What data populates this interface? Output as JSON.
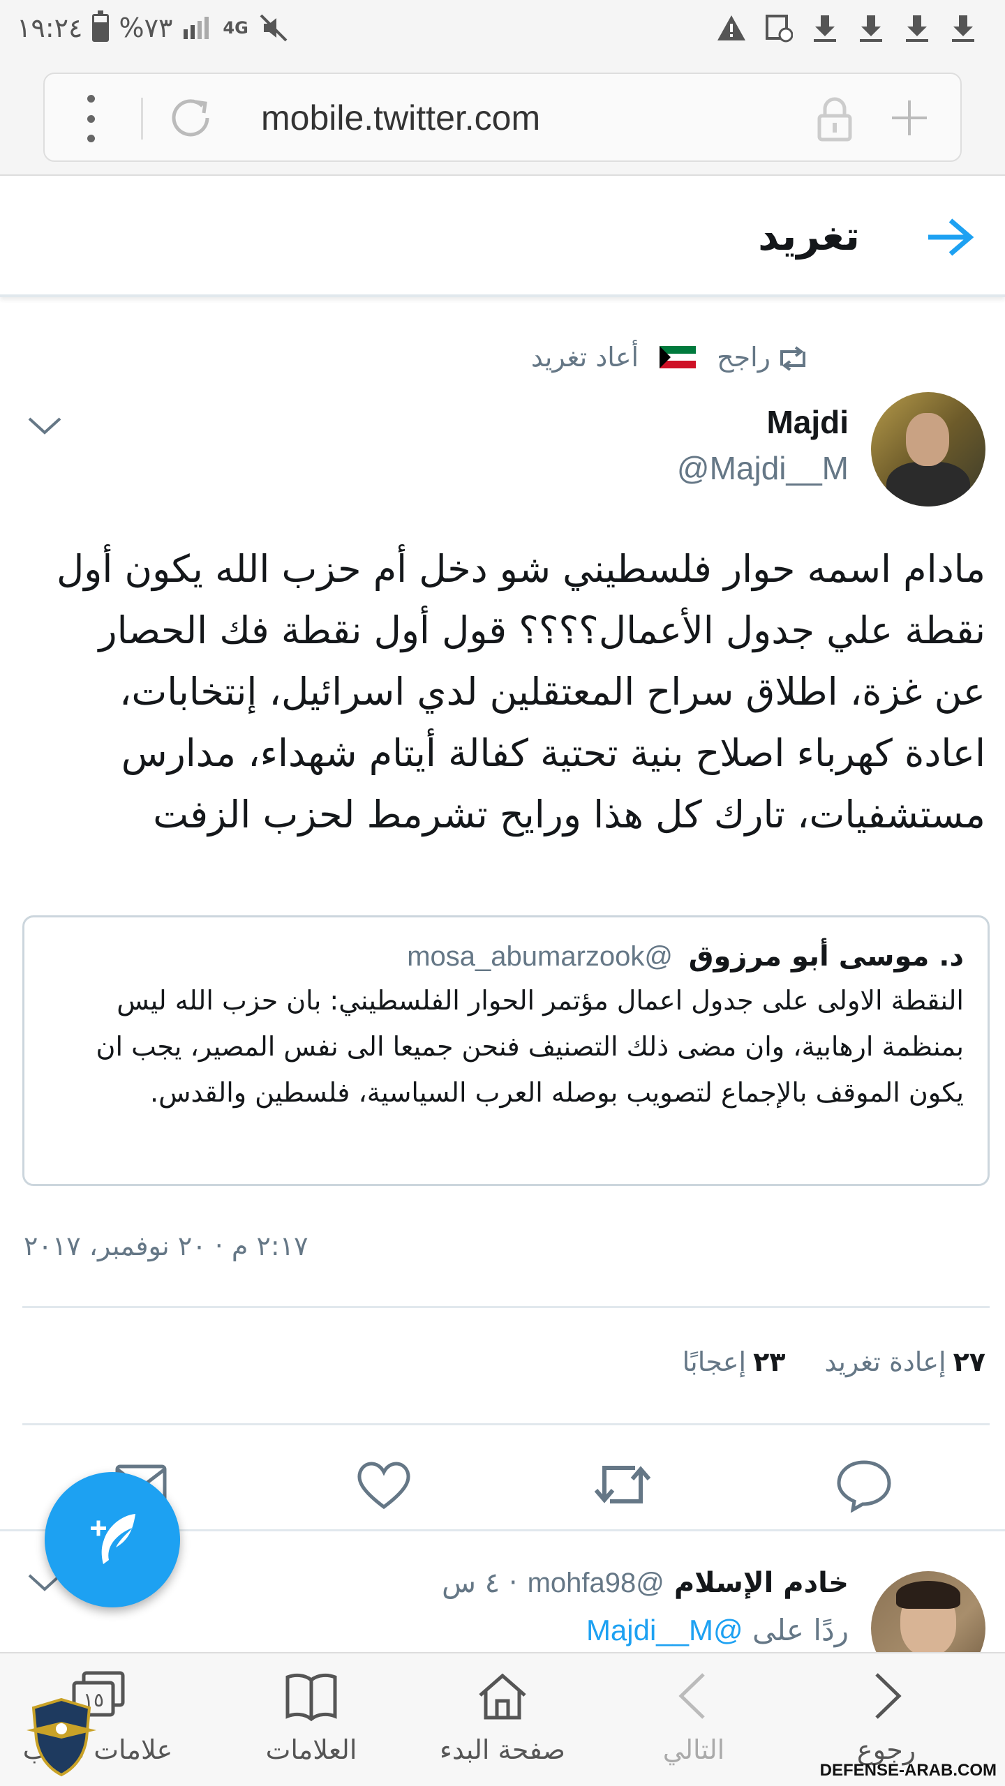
{
  "status_bar": {
    "time": "١٩:٢٤",
    "battery": "%٧٣",
    "battery_level": 0.73,
    "network": "4G"
  },
  "browser": {
    "url": "mobile.twitter.com"
  },
  "header": {
    "title": "تغريد"
  },
  "retweeted_by": {
    "name": "راجح",
    "label": "أعاد تغريد"
  },
  "tweet": {
    "author_name": "Majdi",
    "author_handle": "@Majdi__M",
    "text": "مادام اسمه حوار فلسطيني شو دخل أم حزب الله يكون أول نقطة علي جدول الأعمال؟؟؟؟ قول أول نقطة فك الحصار عن غزة، اطلاق سراح المعتقلين لدي اسرائيل، إنتخابات، اعادة كهرباء اصلاح بنية تحتية كفالة أيتام شهداء، مدارس مستشفيات،  تارك كل هذا ورايح تشرمط لحزب الزفت",
    "quote": {
      "author_name": "د. موسى أبو مرزوق",
      "author_handle": "@mosa_abumarzook",
      "text": "النقطة الاولى على جدول اعمال مؤتمر الحوار الفلسطيني: بان حزب الله ليس بمنظمة ارهابية، وان مضى ذلك التصنيف فنحن جميعا الى نفس المصير، يجب ان يكون الموقف بالإجماع لتصويب بوصله العرب السياسية، فلسطين والقدس."
    },
    "timestamp": "٢:١٧ م · ٢٠ نوفمبر، ٢٠١٧",
    "retweets_count": "٢٧",
    "retweets_label": "إعادة تغريد",
    "likes_count": "٢٣",
    "likes_label": "إعجابًا"
  },
  "reply": {
    "author_name": "خادم الإسلام",
    "author_handle": "@mohfa98",
    "time": "· ٤ س",
    "replying_label": "ردًا على",
    "replying_to": "@Majdi__M"
  },
  "bottom_nav": {
    "back": "رجوع",
    "forward": "التالي",
    "home": "صفحة البدء",
    "bookmarks": "العلامات",
    "tabs": "علامات تبويب",
    "tabs_count": "١٥"
  },
  "watermark": {
    "text": "DEFENSE-ARAB.COM"
  },
  "colors": {
    "accent": "#1da1f2",
    "secondary_text": "#657786",
    "border": "#e1e8ed"
  },
  "icons": [
    "mute-icon",
    "signal-icon",
    "alert-icon",
    "download-icon",
    "retweet-icon",
    "reply-icon",
    "like-icon",
    "dm-icon",
    "compose-icon"
  ]
}
